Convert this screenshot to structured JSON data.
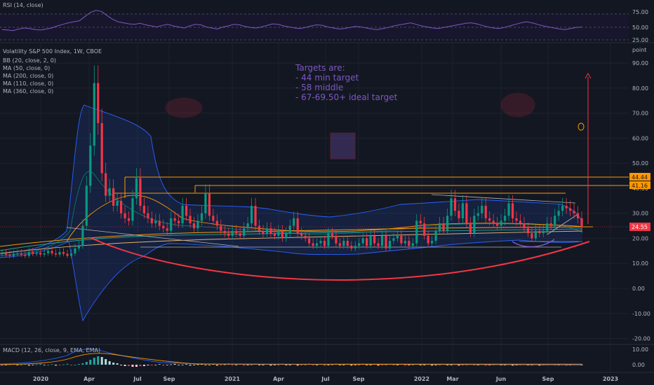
{
  "rsi": {
    "label": "RSI (14, close)",
    "levels": [
      "75.00",
      "50.00",
      "25.00"
    ],
    "values": [
      45,
      44,
      43,
      46,
      48,
      47,
      45,
      44,
      46,
      48,
      52,
      55,
      58,
      60,
      62,
      70,
      78,
      82,
      80,
      72,
      65,
      60,
      58,
      56,
      55,
      57,
      54,
      52,
      50,
      53,
      55,
      52,
      50,
      48,
      52,
      55,
      54,
      50,
      48,
      46,
      50,
      52,
      55,
      54,
      51,
      49,
      48,
      50,
      53,
      56,
      55,
      52,
      50,
      48,
      47,
      49,
      52,
      54,
      53,
      50,
      48,
      46,
      47,
      49,
      51,
      50,
      48,
      46,
      45,
      47,
      49,
      52,
      54,
      56,
      58,
      55,
      52,
      50,
      48,
      47,
      49,
      51,
      53,
      55,
      57,
      58,
      56,
      53,
      50,
      48,
      47,
      49,
      52,
      55,
      58,
      60,
      58,
      55,
      52,
      50,
      48,
      46,
      45,
      47,
      49,
      50
    ]
  },
  "main": {
    "title": "Volatility S&P 500 Index, 1W, CBOE",
    "indicators": [
      "BB (20, close, 2, 0)",
      "MA (50, close, 0)",
      "MA (200, close, 0)",
      "MA (110, close, 0)",
      "MA (360, close, 0)"
    ],
    "unit": "point"
  },
  "annotation": {
    "lines": [
      "Targets are:",
      "- 44 min target",
      "- 58 middle",
      "- 67-69.50+ ideal target"
    ]
  },
  "price_tags": {
    "top": "44.44",
    "mid": "41.16",
    "last": "24.55"
  },
  "macd": {
    "label": "MACD (12, 26, close, 9, EMA, EMA)",
    "levels": [
      "10.00",
      "0.00"
    ]
  },
  "chart_data": {
    "type": "candlestick",
    "ylabel": "point",
    "y_ticks": [
      90,
      80,
      70,
      60,
      50,
      40,
      30,
      20,
      10,
      0,
      -10,
      -20
    ],
    "x_ticks": [
      "2020",
      "Apr",
      "Jul",
      "Sep",
      "2021",
      "Apr",
      "Jul",
      "Sep",
      "2022",
      "Mar",
      "Jun",
      "Sep",
      "2023"
    ],
    "closes": [
      14,
      13.5,
      13,
      13.8,
      14,
      13.5,
      13,
      14.5,
      13.8,
      14.2,
      13.5,
      14,
      15,
      14,
      13.5,
      14.5,
      13.8,
      13,
      14,
      16,
      17,
      25,
      41,
      57,
      82,
      66,
      46,
      37,
      40,
      33,
      35,
      30,
      28,
      27,
      36,
      44,
      33,
      30,
      28,
      26,
      27,
      25,
      24,
      23,
      28,
      27,
      26,
      33,
      29,
      26,
      24,
      27,
      30,
      38,
      29,
      27,
      25,
      23,
      22,
      21,
      23,
      22,
      21,
      24,
      26,
      33,
      25,
      23,
      22,
      24,
      22,
      21,
      23,
      20,
      22,
      25,
      28,
      22,
      21,
      20,
      18,
      17,
      18,
      19,
      17,
      22,
      21,
      18,
      17,
      19,
      17,
      16,
      17,
      18,
      20,
      17,
      21,
      18,
      17,
      21,
      16,
      19,
      20,
      21,
      18,
      19,
      17,
      18,
      27,
      26,
      21,
      18,
      19,
      23,
      26,
      23,
      29,
      36,
      31,
      28,
      34,
      26,
      22,
      29,
      30,
      33,
      28,
      27,
      26,
      25,
      27,
      29,
      34,
      28,
      27,
      26,
      24,
      22,
      20,
      23,
      22,
      23,
      26,
      25,
      29,
      31,
      33,
      32,
      31,
      30,
      28,
      24.55
    ]
  }
}
